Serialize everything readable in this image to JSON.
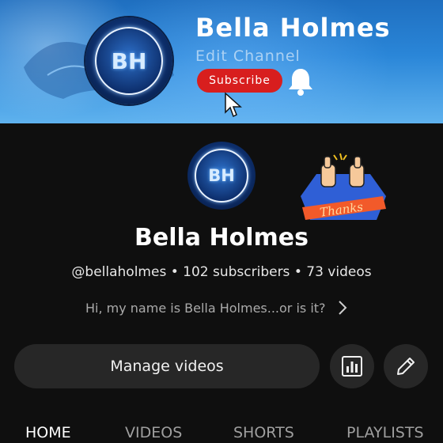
{
  "banner": {
    "logo_text": "BH",
    "channel_name": "Bella Holmes",
    "edit_text": "Edit Channel",
    "subscribe_label": "Subscribe",
    "subscribe_color": "#d81e1e",
    "icons": [
      "bell-icon",
      "cursor-icon"
    ]
  },
  "avatar": {
    "logo_text": "BH"
  },
  "sticker": {
    "text": "Thanks"
  },
  "channel": {
    "name": "Bella Holmes",
    "meta": "@bellaholmes • 102 subscribers • 73 videos",
    "description": "Hi, my name is Bella Holmes...or is it?"
  },
  "actions": {
    "manage_label": "Manage videos",
    "icons": [
      "analytics-icon",
      "pencil-icon"
    ]
  },
  "tabs": [
    {
      "label": "HOME",
      "active": true
    },
    {
      "label": "VIDEOS",
      "active": false
    },
    {
      "label": "SHORTS",
      "active": false
    },
    {
      "label": "PLAYLISTS",
      "active": false
    }
  ],
  "colors": {
    "background": "#0f0f0f",
    "button_bg": "#272727",
    "accent_red": "#d81e1e"
  }
}
